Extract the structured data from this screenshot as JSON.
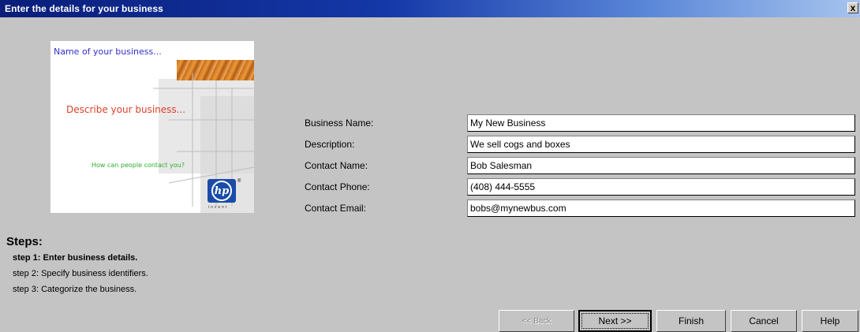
{
  "window": {
    "title": "Enter the details for your business",
    "close_glyph": "x"
  },
  "banner": {
    "name_prompt": "Name of your business...",
    "describe_prompt": "Describe your business...",
    "contact_prompt": "How can people contact you?",
    "logo_text": "hp",
    "logo_tagline": "invent",
    "logo_mark": "®"
  },
  "form": {
    "fields": [
      {
        "label": "Business Name:",
        "value": "My New Business"
      },
      {
        "label": "Description:",
        "value": "We sell cogs and boxes"
      },
      {
        "label": "Contact Name:",
        "value": "Bob Salesman"
      },
      {
        "label": "Contact Phone:",
        "value": "(408) 444-5555"
      },
      {
        "label": "Contact Email:",
        "value": "bobs@mynewbus.com"
      }
    ]
  },
  "steps": {
    "heading": "Steps:",
    "items": [
      {
        "label": "step 1: Enter business details.",
        "active": true
      },
      {
        "label": "step 2: Specify business identifiers.",
        "active": false
      },
      {
        "label": "step 3: Categorize the business.",
        "active": false
      }
    ]
  },
  "buttons": {
    "back": "<< Back",
    "next": "Next >>",
    "finish": "Finish",
    "cancel": "Cancel",
    "help": "Help"
  }
}
